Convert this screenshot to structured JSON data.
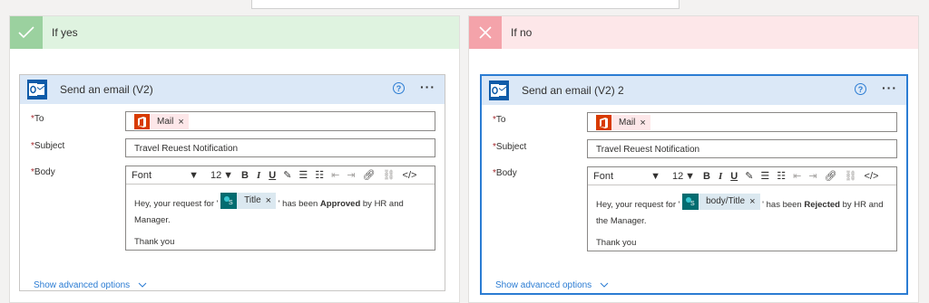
{
  "yes_branch": {
    "title": "If yes",
    "action": {
      "title": "Send an email (V2)",
      "to_label": "To",
      "to_token": "Mail",
      "subject_label": "Subject",
      "subject_value": "Travel Reuest Notification",
      "body_label": "Body",
      "font": "Font",
      "font_size": "12",
      "body_pre": "Hey, your request for '",
      "body_token": "Title",
      "body_mid": "' has been",
      "body_status": "Approved",
      "body_post": "by HR and",
      "body_line2": "Manager.",
      "body_thanks": "Thank you",
      "advanced": "Show advanced options"
    }
  },
  "no_branch": {
    "title": "If no",
    "action": {
      "title": "Send an email (V2) 2",
      "to_label": "To",
      "to_token": "Mail",
      "subject_label": "Subject",
      "subject_value": "Travel Reuest Notification",
      "body_label": "Body",
      "font": "Font",
      "font_size": "12",
      "body_pre": "Hey, your request for '",
      "body_token": "body/Title",
      "body_mid": "' has been",
      "body_status": "Rejected",
      "body_post": "by HR and",
      "body_line2": "the Manager.",
      "body_thanks": "Thank you",
      "advanced": "Show advanced options"
    }
  },
  "common": {
    "required_mark": "*",
    "help": "?",
    "more": "···",
    "close": "×"
  },
  "colors": {
    "yes_bg": "#dff3e0",
    "no_bg": "#fde7e9",
    "accent": "#2b7cd3",
    "office_red": "#d83b01",
    "sharepoint_teal": "#036c70"
  }
}
